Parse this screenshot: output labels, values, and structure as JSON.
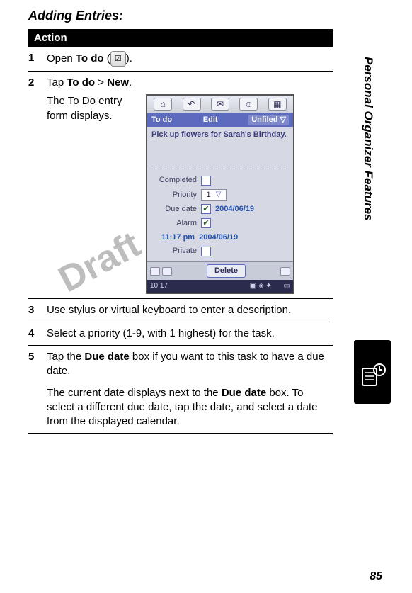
{
  "heading": "Adding Entries:",
  "action_header": "Action",
  "sidebar_label": "Personal Organizer Features",
  "page_number": "85",
  "watermark": "Draft",
  "steps": {
    "s1": {
      "num": "1",
      "prefix": "Open ",
      "bold": "To do",
      "suffix": " (",
      "suffix2": ")."
    },
    "s2": {
      "num": "2",
      "line_prefix": "Tap ",
      "tap1": "To do",
      "gt": " > ",
      "tap2": "New",
      "period": ".",
      "body": "The To Do entry form displays."
    },
    "s3": {
      "num": "3",
      "text": "Use stylus or virtual keyboard to enter a description."
    },
    "s4": {
      "num": "4",
      "text": "Select a priority (1-9, with 1 highest) for the task."
    },
    "s5": {
      "num": "5",
      "prefix": "Tap the ",
      "bold1": "Due date",
      "mid": " box if you want to this task to have a due date.",
      "p2a": "The current date displays next to the ",
      "bold2": "Due date",
      "p2b": " box. To select a different due date, tap the date, and select a date from the displayed calendar."
    }
  },
  "pda": {
    "menu_todo": "To do",
    "menu_edit": "Edit",
    "unfiled": "Unfiled ▽",
    "desc": "Pick up flowers for Sarah's Birthday.",
    "labels": {
      "completed": "Completed",
      "priority": "Priority",
      "duedate": "Due date",
      "alarm": "Alarm",
      "private": "Private"
    },
    "priority_value": "1",
    "due_date_value": "2004/06/19",
    "alarm_time": "11:17 pm",
    "alarm_date": "2004/06/19",
    "delete": "Delete",
    "status_time": "10:17"
  }
}
